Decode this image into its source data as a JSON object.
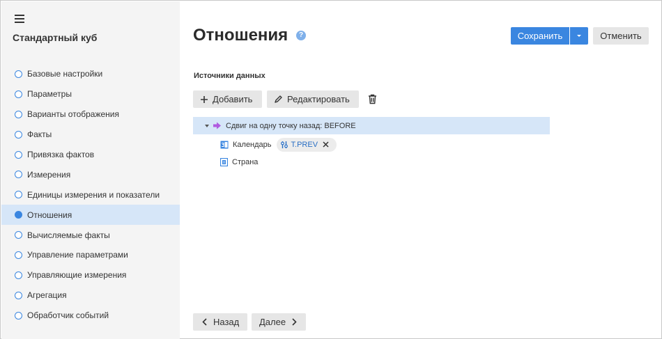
{
  "sidebar": {
    "title": "Стандартный куб",
    "items": [
      {
        "label": "Базовые настройки"
      },
      {
        "label": "Параметры"
      },
      {
        "label": "Варианты отображения"
      },
      {
        "label": "Факты"
      },
      {
        "label": "Привязка фактов"
      },
      {
        "label": "Измерения"
      },
      {
        "label": "Единицы измерения и показатели"
      },
      {
        "label": "Отношения",
        "active": true
      },
      {
        "label": "Вычисляемые факты"
      },
      {
        "label": "Управление параметрами"
      },
      {
        "label": "Управляющие измерения"
      },
      {
        "label": "Агрегация"
      },
      {
        "label": "Обработчик событий"
      }
    ]
  },
  "header": {
    "title": "Отношения",
    "help": "?",
    "save_label": "Сохранить",
    "cancel_label": "Отменить"
  },
  "sources": {
    "title": "Источники данных",
    "add_label": "Добавить",
    "edit_label": "Редактировать",
    "tree": {
      "root_label": "Сдвиг на одну точку назад: BEFORE",
      "children": [
        {
          "label": "Календарь",
          "chip": "T.PREV"
        },
        {
          "label": "Страна"
        }
      ]
    }
  },
  "footer": {
    "back_label": "Назад",
    "next_label": "Далее"
  },
  "colors": {
    "accent": "#3a86e0",
    "selected_bg": "#d6e6f8",
    "relation_icon": "#b05be0"
  }
}
